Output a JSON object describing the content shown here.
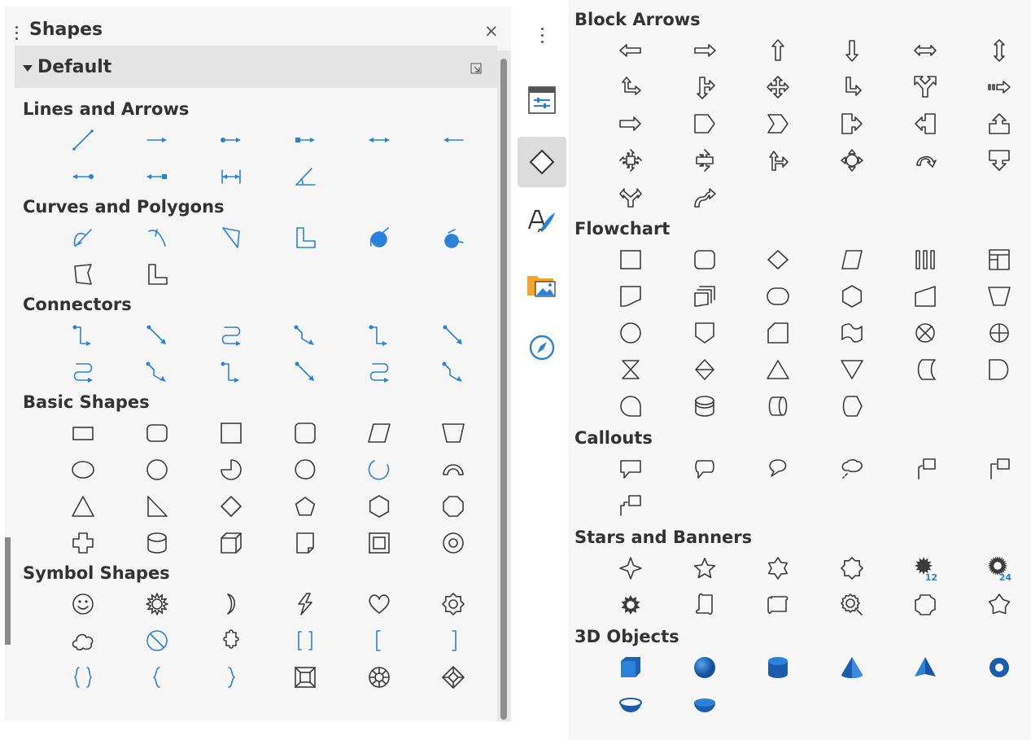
{
  "panel": {
    "title": "Shapes",
    "close_label": "×",
    "group_title": "Default"
  },
  "left_sections": [
    {
      "title": "Lines and Arrows",
      "top": 0,
      "rows": [
        [
          "line",
          "line-arrow",
          "line-dot-arrow",
          "line-square-arrow",
          "line-arrows-both",
          "line-arrow-left"
        ],
        [
          "line-arrow-dot-left",
          "line-arrow-square-left",
          "dimension-line",
          "angle-line"
        ]
      ]
    },
    {
      "title": "Curves and Polygons",
      "rows": [
        [
          "curve",
          "bezier",
          "polygon",
          "polygon-45",
          "filled-curve",
          "filled-blob"
        ],
        [
          "polygon-filled",
          "polygon-45-outline"
        ]
      ]
    },
    {
      "title": "Connectors",
      "rows": [
        [
          "connector-elbow",
          "connector-line",
          "connector-curved",
          "connector-elbow-2",
          "connector-elbow",
          "connector-line"
        ],
        [
          "connector-curved",
          "connector-elbow-2",
          "connector-elbow",
          "connector-line",
          "connector-curved",
          "connector-elbow-2"
        ]
      ]
    },
    {
      "title": "Basic Shapes",
      "rows": [
        [
          "rectangle",
          "rounded-rectangle",
          "square",
          "rounded-square",
          "parallelogram",
          "trapezoid"
        ],
        [
          "ellipse",
          "circle",
          "circle-pie",
          "blob",
          "arc",
          "block-arc"
        ],
        [
          "triangle",
          "right-triangle",
          "diamond",
          "pentagon",
          "hexagon",
          "octagon"
        ],
        [
          "cross",
          "cylinder",
          "cube",
          "folded-corner",
          "frame",
          "ring"
        ]
      ]
    },
    {
      "title": "Symbol Shapes",
      "rows": [
        [
          "smiley",
          "sun",
          "moon",
          "lightning",
          "heart",
          "flower"
        ],
        [
          "cloud",
          "prohibited",
          "puzzle",
          "double-bracket",
          "left-bracket",
          "right-bracket"
        ],
        [
          "double-brace",
          "left-brace",
          "right-brace",
          "square-bevel",
          "octagon-bevel",
          "diamond-bevel"
        ]
      ]
    }
  ],
  "right_sections": [
    {
      "title": "Block Arrows",
      "rows": [
        [
          "arrow-left",
          "arrow-right",
          "arrow-up",
          "arrow-down",
          "arrow-left-right",
          "arrow-up-down"
        ],
        [
          "arrow-up-right",
          "arrow-right-down",
          "arrow-4way",
          "arrow-corner-right",
          "arrow-split",
          "arrow-notched-right"
        ],
        [
          "arrow-striped-right",
          "pentagon-arrow",
          "chevron",
          "callout-arrow-right",
          "callout-arrow-left",
          "callout-arrow-up"
        ],
        [
          "callout-arrow-4way",
          "callout-arrow-up-down",
          "arrow-up-right-down",
          "arrow-4way-circle",
          "arrow-circular",
          "callout-arrow-down"
        ],
        [
          "arrow-split-up",
          "arrow-s-shaped"
        ]
      ]
    },
    {
      "title": "Flowchart",
      "rows": [
        [
          "fc-process",
          "fc-alternate-process",
          "fc-decision",
          "fc-data",
          "fc-predefined-process",
          "fc-internal-storage"
        ],
        [
          "fc-document",
          "fc-multidocument",
          "fc-terminator",
          "fc-preparation",
          "fc-manual-input",
          "fc-manual-operation"
        ],
        [
          "fc-connector",
          "fc-offpage-connector",
          "fc-card",
          "fc-punched-tape",
          "fc-summing-junction",
          "fc-or"
        ],
        [
          "fc-collate",
          "fc-sort",
          "fc-extract",
          "fc-merge",
          "fc-stored-data",
          "fc-delay"
        ],
        [
          "fc-sequential-access",
          "fc-magnetic-disc",
          "fc-direct-access",
          "fc-display"
        ]
      ]
    },
    {
      "title": "Callouts",
      "rows": [
        [
          "callout-rectangular",
          "callout-rounded",
          "callout-round",
          "callout-cloud",
          "callout-line-1",
          "callout-line-2"
        ],
        [
          "callout-line-3"
        ]
      ]
    },
    {
      "title": "Stars and Banners",
      "rows": [
        [
          "star-4",
          "star-5",
          "star-6",
          "star-8",
          "star-12",
          "star-24"
        ],
        [
          "explosion",
          "scroll-vertical",
          "scroll-horizontal",
          "signet",
          "doorplate",
          "concave-star"
        ]
      ]
    },
    {
      "title": "3D Objects",
      "rows": [
        [
          "cube-3d",
          "sphere-3d",
          "cylinder-3d",
          "cone-3d",
          "pyramid-3d",
          "torus-3d"
        ],
        [
          "shell-3d",
          "half-sphere-3d"
        ]
      ]
    }
  ],
  "badges": {
    "star-12": "12",
    "star-24": "24"
  },
  "colors": {
    "blue": "#2a82da",
    "dark": "#3c3c3c",
    "panel_bg": "#f6f6f6",
    "header_bg": "#e4e4e4"
  },
  "sidebar_tabs": [
    {
      "icon": "properties-icon",
      "active": false
    },
    {
      "icon": "shapes-icon",
      "active": true
    },
    {
      "icon": "styles-icon",
      "active": false
    },
    {
      "icon": "gallery-icon",
      "active": false
    },
    {
      "icon": "navigator-icon",
      "active": false
    }
  ]
}
